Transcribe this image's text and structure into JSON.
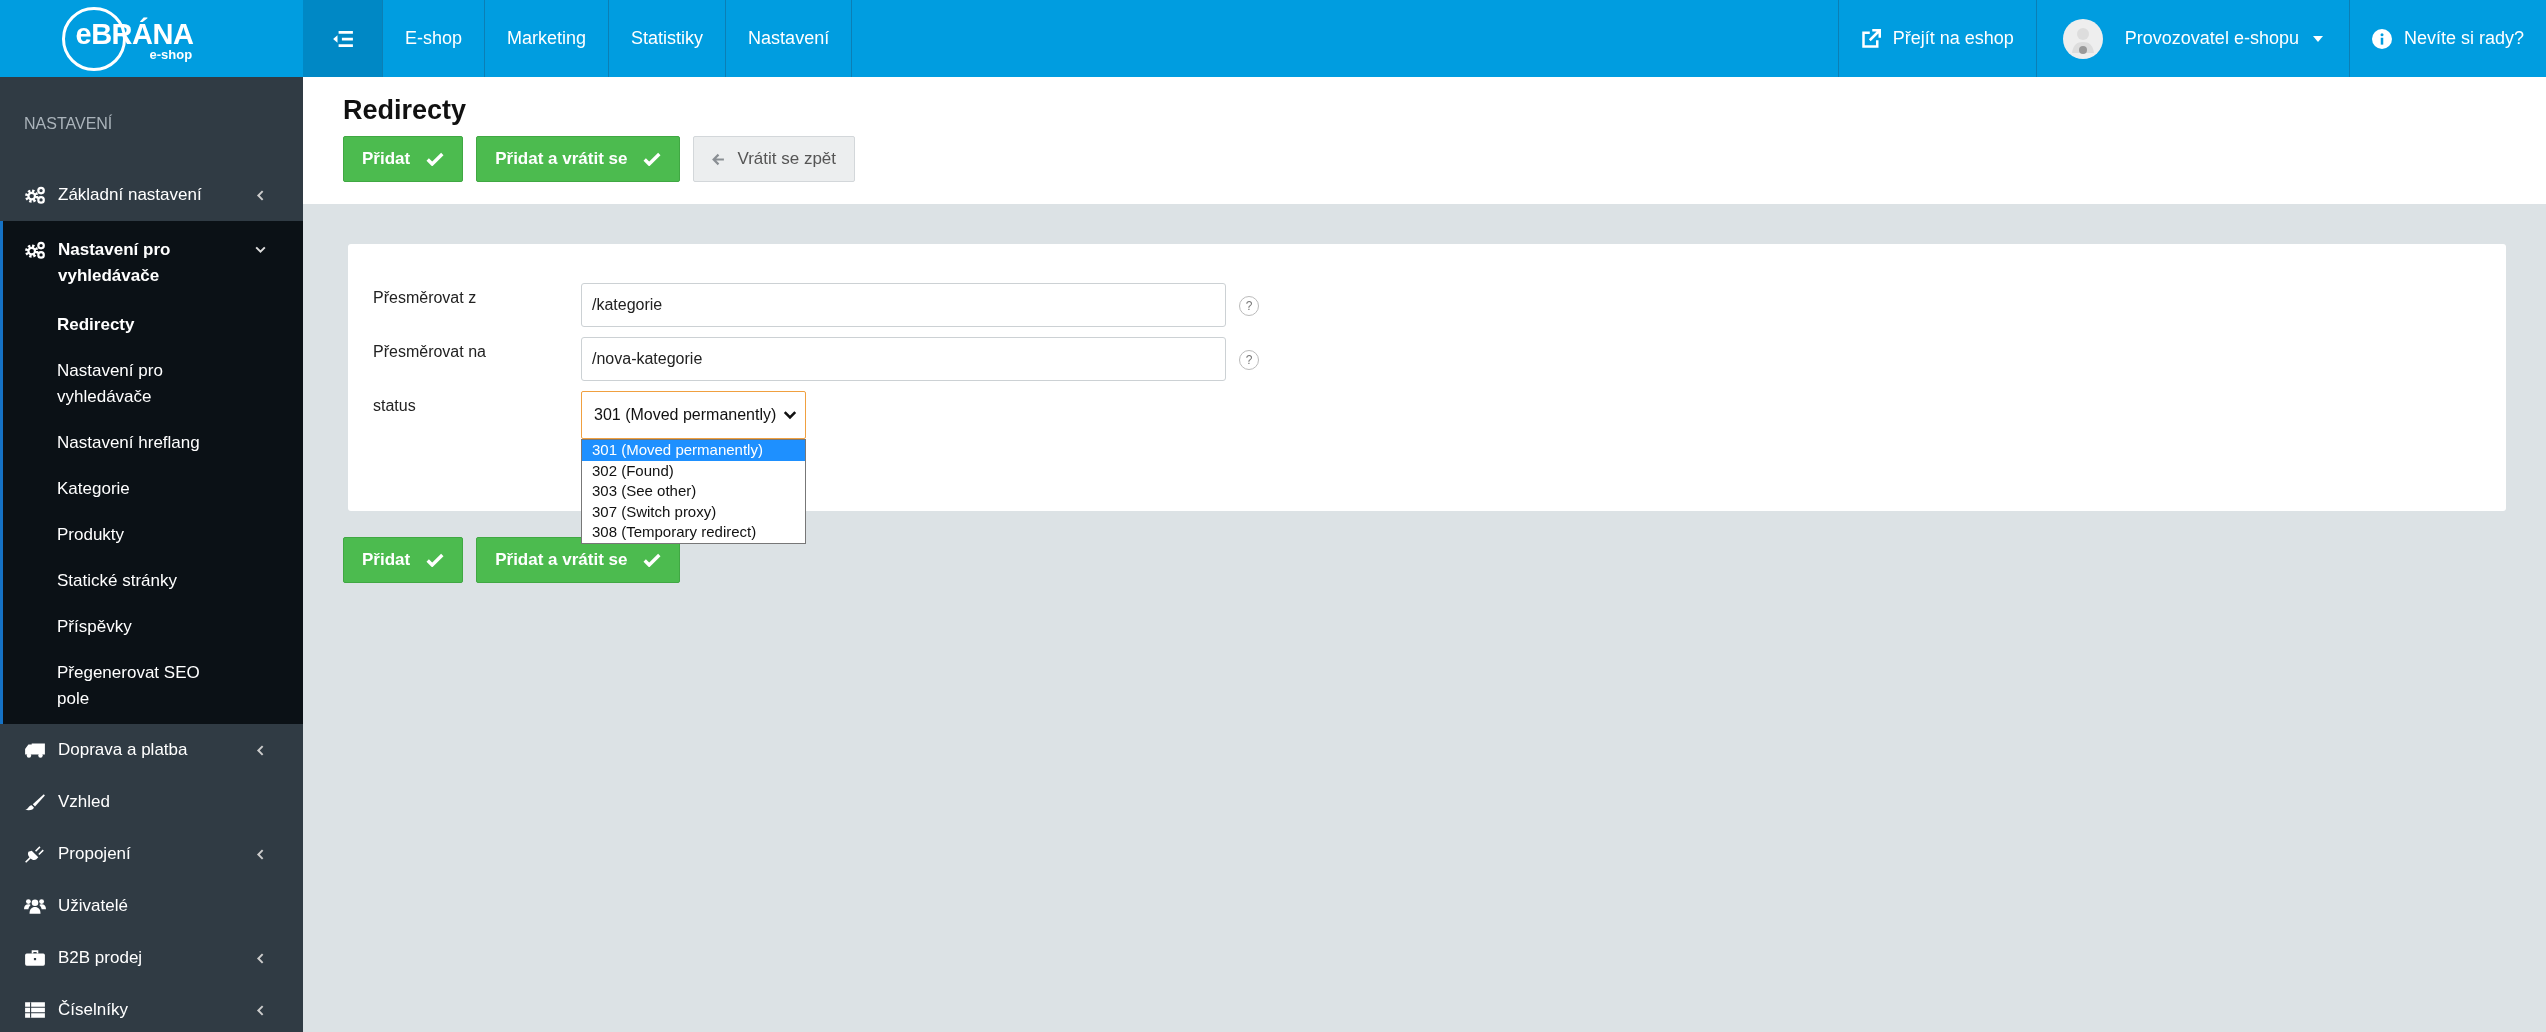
{
  "header": {
    "logo": {
      "title": "eBRÁNA",
      "subtitle": "e-shop"
    },
    "nav": [
      {
        "label": "E-shop"
      },
      {
        "label": "Marketing"
      },
      {
        "label": "Statistiky"
      },
      {
        "label": "Nastavení"
      }
    ],
    "shop_link": "Přejít na eshop",
    "user": "Provozovatel e-shopu",
    "help": "Nevíte si rady?"
  },
  "sidebar": {
    "heading": "NASTAVENÍ",
    "items": [
      {
        "label": "Základní nastavení",
        "expandable": true,
        "expanded": false
      },
      {
        "label": "Nastavení pro vyhledávače",
        "expandable": true,
        "expanded": true,
        "children": [
          {
            "label": "Redirecty",
            "selected": true
          },
          {
            "label": "Nastavení pro vyhledávače",
            "selected": false
          },
          {
            "label": "Nastavení hreflang",
            "selected": false
          },
          {
            "label": "Kategorie",
            "selected": false
          },
          {
            "label": "Produkty",
            "selected": false
          },
          {
            "label": "Statické stránky",
            "selected": false
          },
          {
            "label": "Příspěvky",
            "selected": false
          },
          {
            "label": "Přegenerovat SEO pole",
            "selected": false
          }
        ]
      },
      {
        "label": "Doprava a platba",
        "expandable": true,
        "expanded": false
      },
      {
        "label": "Vzhled",
        "expandable": false,
        "expanded": false
      },
      {
        "label": "Propojení",
        "expandable": true,
        "expanded": false
      },
      {
        "label": "Uživatelé",
        "expandable": false,
        "expanded": false
      },
      {
        "label": "B2B prodej",
        "expandable": true,
        "expanded": false
      },
      {
        "label": "Číselníky",
        "expandable": true,
        "expanded": false
      }
    ]
  },
  "page": {
    "title": "Redirecty",
    "top_buttons": [
      {
        "label": "Přidat",
        "kind": "primary"
      },
      {
        "label": "Přidat a vrátit se",
        "kind": "primary"
      },
      {
        "label": "Vrátit se zpět",
        "kind": "back"
      }
    ],
    "fields": [
      {
        "label": "Přesměrovat z",
        "kind": "text",
        "value": "/kategorie",
        "help": "?"
      },
      {
        "label": "Přesměrovat na",
        "kind": "text",
        "value": "/nova-kategorie",
        "help": "?"
      },
      {
        "label": "status",
        "kind": "select",
        "value": "301 (Moved permanently)",
        "open": true,
        "options": [
          {
            "label": "301 (Moved permanently)",
            "selected": true
          },
          {
            "label": "302 (Found)",
            "selected": false
          },
          {
            "label": "303 (See other)",
            "selected": false
          },
          {
            "label": "307 (Switch proxy)",
            "selected": false
          },
          {
            "label": "308 (Temporary redirect)",
            "selected": false
          }
        ]
      }
    ],
    "bottom_buttons": [
      {
        "label": "Přidat",
        "kind": "primary"
      },
      {
        "label": "Přidat a vrátit se",
        "kind": "primary"
      }
    ]
  }
}
